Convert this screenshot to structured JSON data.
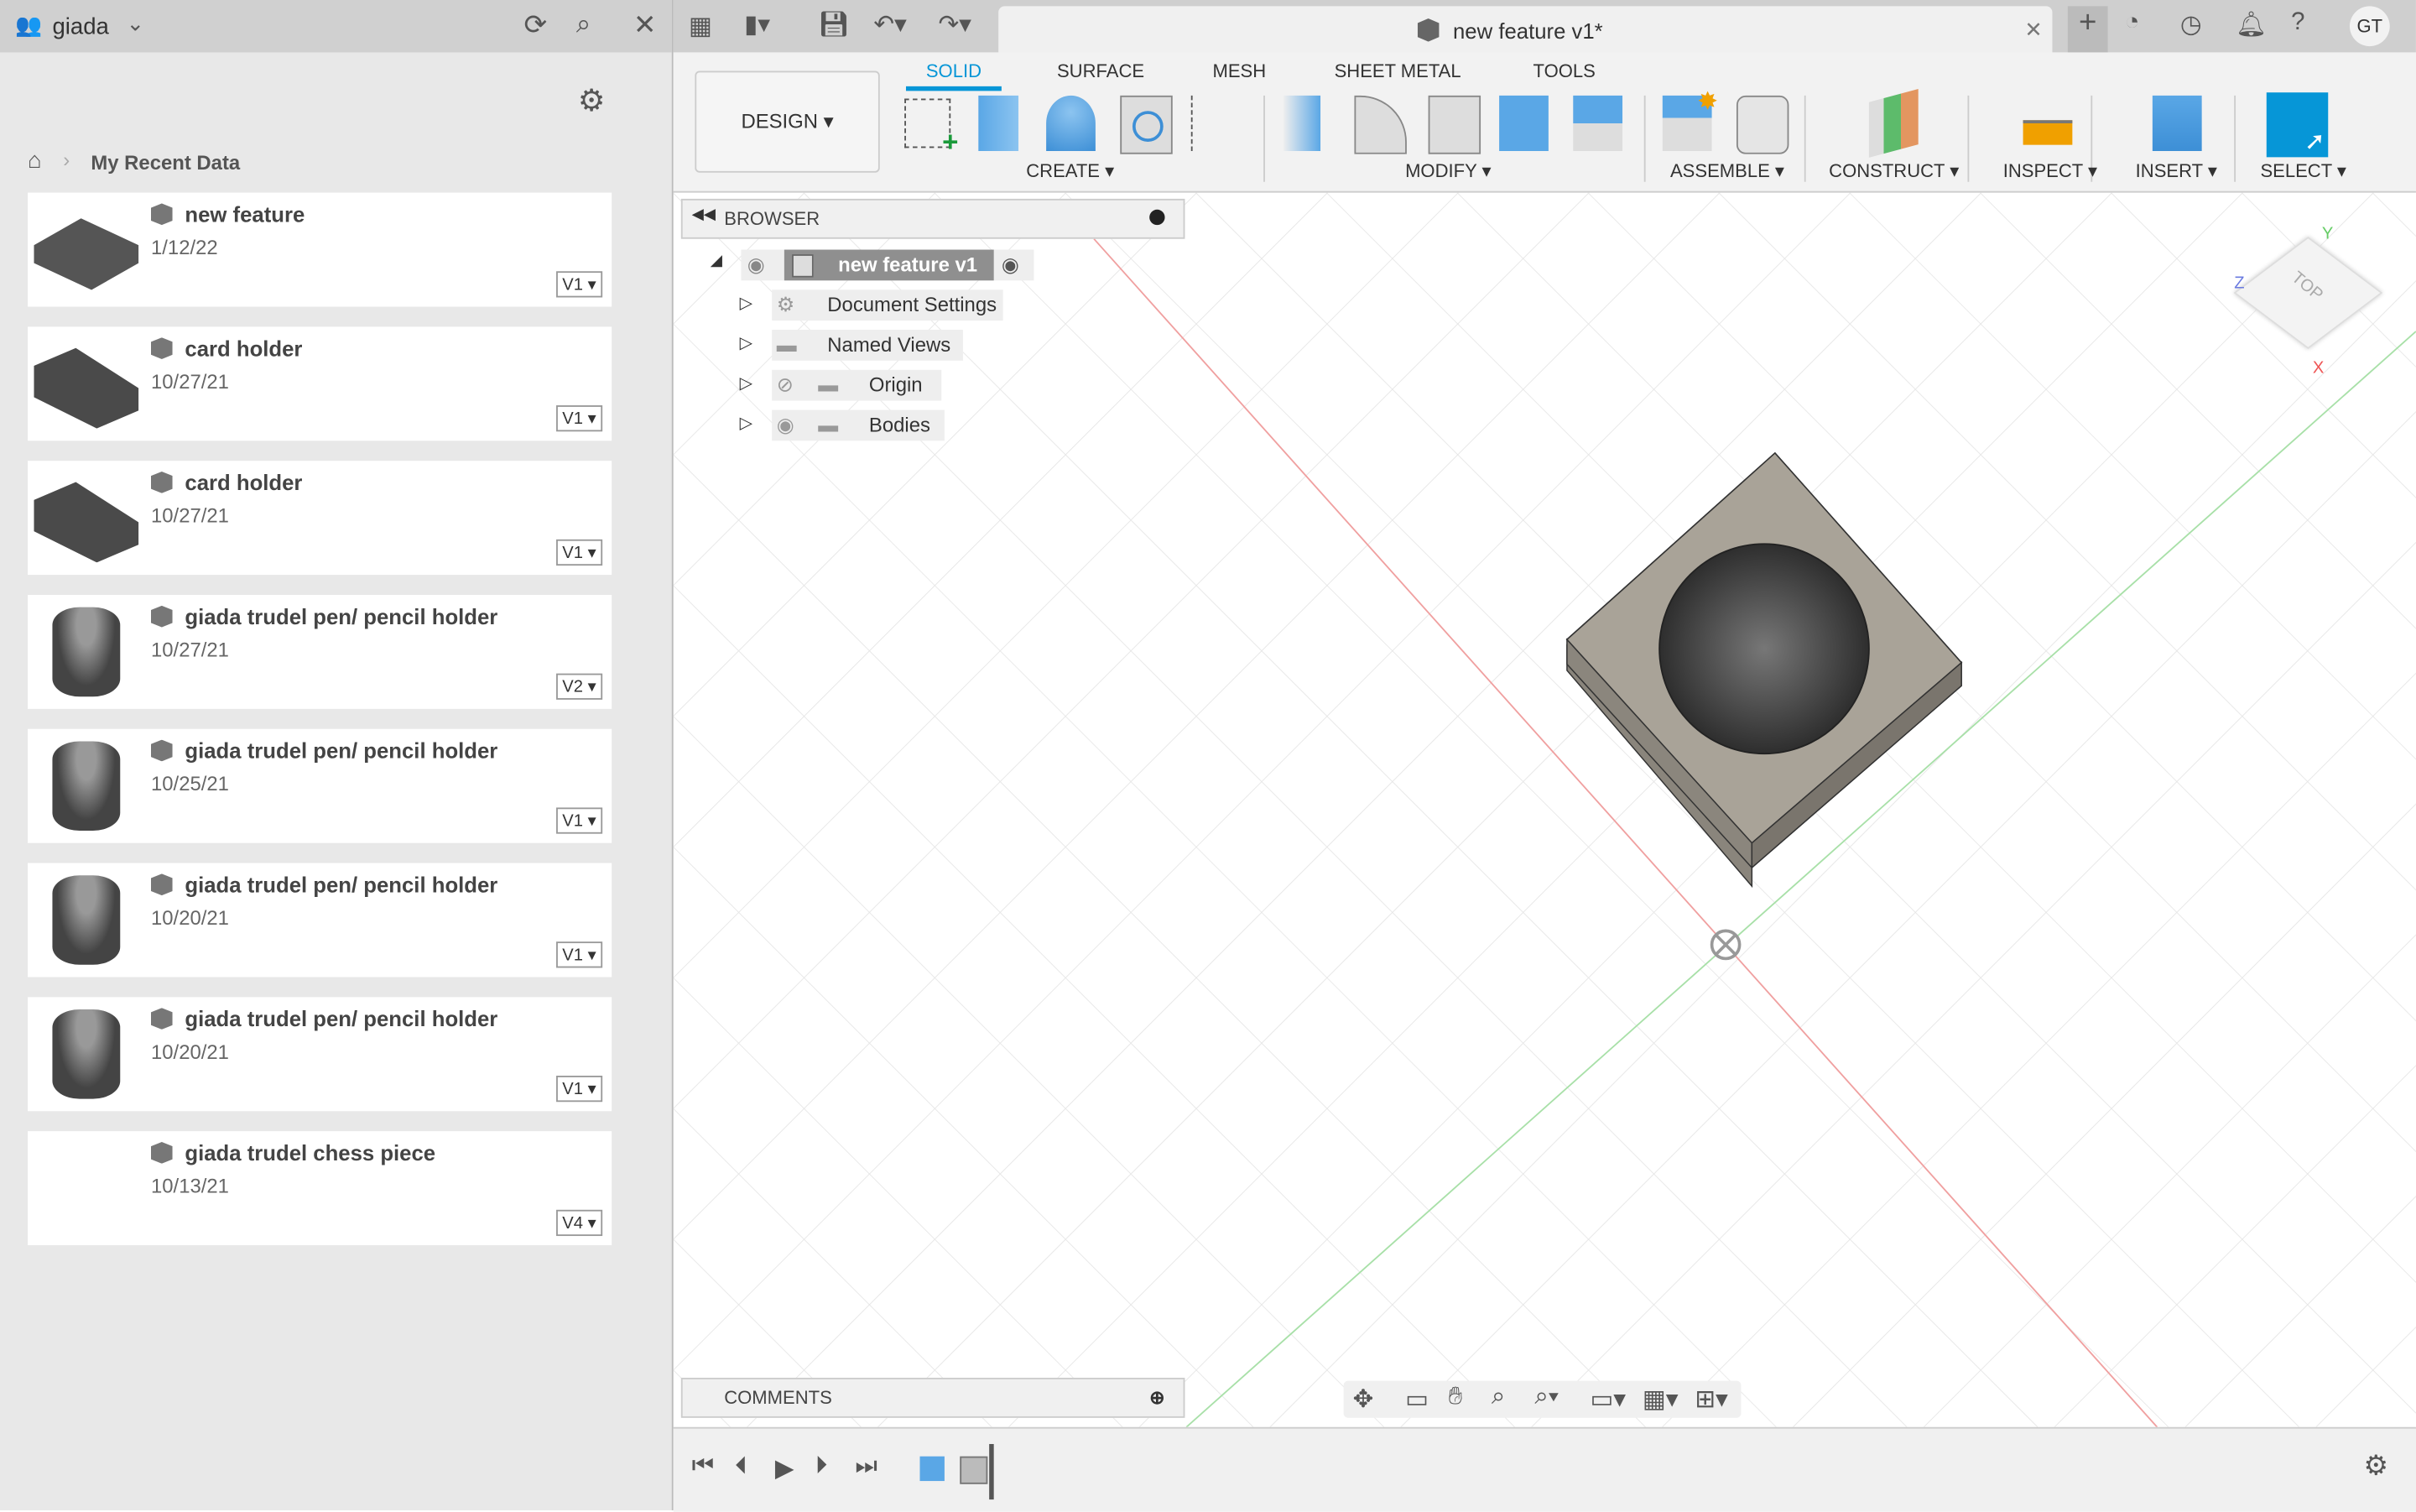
{
  "left_panel": {
    "team": "giada",
    "breadcrumb": "My Recent Data",
    "items": [
      {
        "title": "new feature",
        "date": "1/12/22",
        "version": "V1"
      },
      {
        "title": "card holder",
        "date": "10/27/21",
        "version": "V1"
      },
      {
        "title": "card holder",
        "date": "10/27/21",
        "version": "V1"
      },
      {
        "title": "giada trudel pen/ pencil holder",
        "date": "10/27/21",
        "version": "V2"
      },
      {
        "title": "giada trudel pen/ pencil holder",
        "date": "10/25/21",
        "version": "V1"
      },
      {
        "title": "giada trudel pen/ pencil holder",
        "date": "10/20/21",
        "version": "V1"
      },
      {
        "title": "giada trudel pen/ pencil holder",
        "date": "10/20/21",
        "version": "V1"
      },
      {
        "title": "giada trudel chess piece",
        "date": "10/13/21",
        "version": "V4"
      }
    ]
  },
  "tab": {
    "title": "new feature v1*",
    "user": "GT"
  },
  "toolbar": {
    "workspace": "DESIGN ▾",
    "tabs": [
      "SOLID",
      "SURFACE",
      "MESH",
      "SHEET METAL",
      "TOOLS"
    ],
    "groups": [
      "CREATE ▾",
      "MODIFY ▾",
      "ASSEMBLE ▾",
      "CONSTRUCT ▾",
      "INSPECT ▾",
      "INSERT ▾",
      "SELECT ▾"
    ]
  },
  "browser": {
    "title": "BROWSER",
    "root": "new feature v1",
    "items": [
      "Document Settings",
      "Named Views",
      "Origin",
      "Bodies"
    ]
  },
  "comments": {
    "title": "COMMENTS"
  },
  "viewcube": {
    "face": "TOP",
    "axes": [
      "Z",
      "Y",
      "X"
    ]
  },
  "colors": {
    "accent": "#0696d7",
    "x_axis": "#e88",
    "y_axis": "#8d8"
  }
}
